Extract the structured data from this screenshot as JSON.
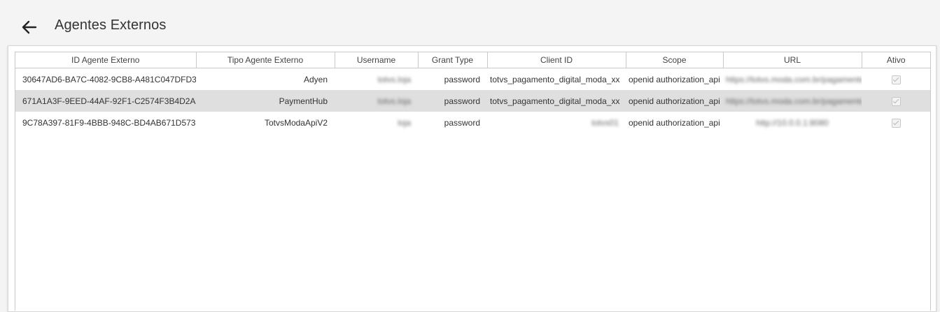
{
  "header": {
    "title": "Agentes Externos"
  },
  "table": {
    "columns": [
      "ID Agente Externo",
      "Tipo Agente Externo",
      "Username",
      "Grant Type",
      "Client ID",
      "Scope",
      "URL",
      "Ativo"
    ],
    "rows": [
      {
        "id": "30647AD6-BA7C-4082-9CB8-A481C047DFD3",
        "tipo": "Adyen",
        "username": "totvs.loja",
        "grant_type": "password",
        "client_id": "totvs_pagamento_digital_moda_xx",
        "scope": "openid authorization_api",
        "url": "https://totvs.moda.com.br/pagamentos",
        "ativo": true
      },
      {
        "id": "671A1A3F-9EED-44AF-92F1-C2574F3B4D2A",
        "tipo": "PaymentHub",
        "username": "totvs.loja",
        "grant_type": "password",
        "client_id": "totvs_pagamento_digital_moda_xx",
        "scope": "openid authorization_api",
        "url": "https://totvs.moda.com.br/pagamentos",
        "ativo": true
      },
      {
        "id": "9C78A397-81F9-4BBB-948C-BD4AB671D573",
        "tipo": "TotvsModaApiV2",
        "username": "loja",
        "grant_type": "password",
        "client_id": "totvs01",
        "scope": "openid authorization_api",
        "url": "http://10.0.0.1:8080",
        "ativo": true
      }
    ]
  }
}
